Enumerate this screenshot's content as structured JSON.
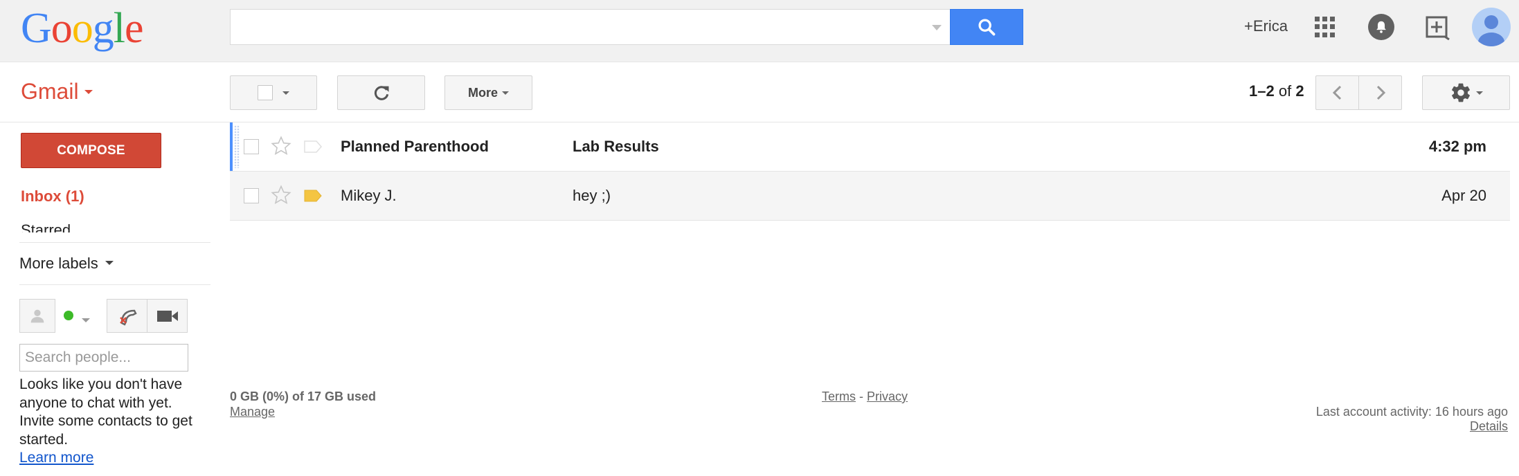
{
  "header": {
    "logo_letters": [
      "G",
      "o",
      "o",
      "g",
      "l",
      "e"
    ],
    "search": {
      "value": "",
      "placeholder": ""
    },
    "user_name": "+Erica",
    "icons": {
      "search": "search-icon",
      "apps": "apps-grid-icon",
      "notifications": "bell-icon",
      "share": "share-box-icon",
      "avatar": "avatar-icon"
    },
    "colors": {
      "search_button": "#4285f4",
      "topbar_bg": "#f1f1f1"
    }
  },
  "toolbar": {
    "app_label": "Gmail",
    "more_label": "More",
    "pager": {
      "start": "1",
      "end": "2",
      "of_label": "of",
      "total": "2",
      "separator": "–"
    },
    "icons": {
      "select": "checkbox-icon",
      "refresh": "refresh-icon",
      "prev": "chevron-left-icon",
      "next": "chevron-right-icon",
      "settings": "gear-icon"
    }
  },
  "sidebar": {
    "compose_label": "COMPOSE",
    "compose_color": "#d14836",
    "inbox_label": "Inbox (1)",
    "starred_label": "Starred",
    "more_labels": "More labels",
    "chat": {
      "status_color": "#3cba28",
      "search_placeholder": "Search people...",
      "empty_message": "Looks like you don't have anyone to chat with yet. Invite some contacts to get started.",
      "learn_more": "Learn more"
    }
  },
  "messages": [
    {
      "sender": "Planned Parenthood",
      "subject": "Lab Results",
      "date": "4:32 pm",
      "unread": true,
      "starred": false,
      "important": false
    },
    {
      "sender": "Mikey J.",
      "subject": "hey ;)",
      "date": "Apr 20",
      "unread": false,
      "starred": false,
      "important": true
    }
  ],
  "footer": {
    "storage": "0 GB (0%) of 17 GB used",
    "manage": "Manage",
    "terms": "Terms",
    "separator": "-",
    "privacy": "Privacy",
    "last_activity": "Last account activity: 16 hours ago",
    "details": "Details"
  }
}
